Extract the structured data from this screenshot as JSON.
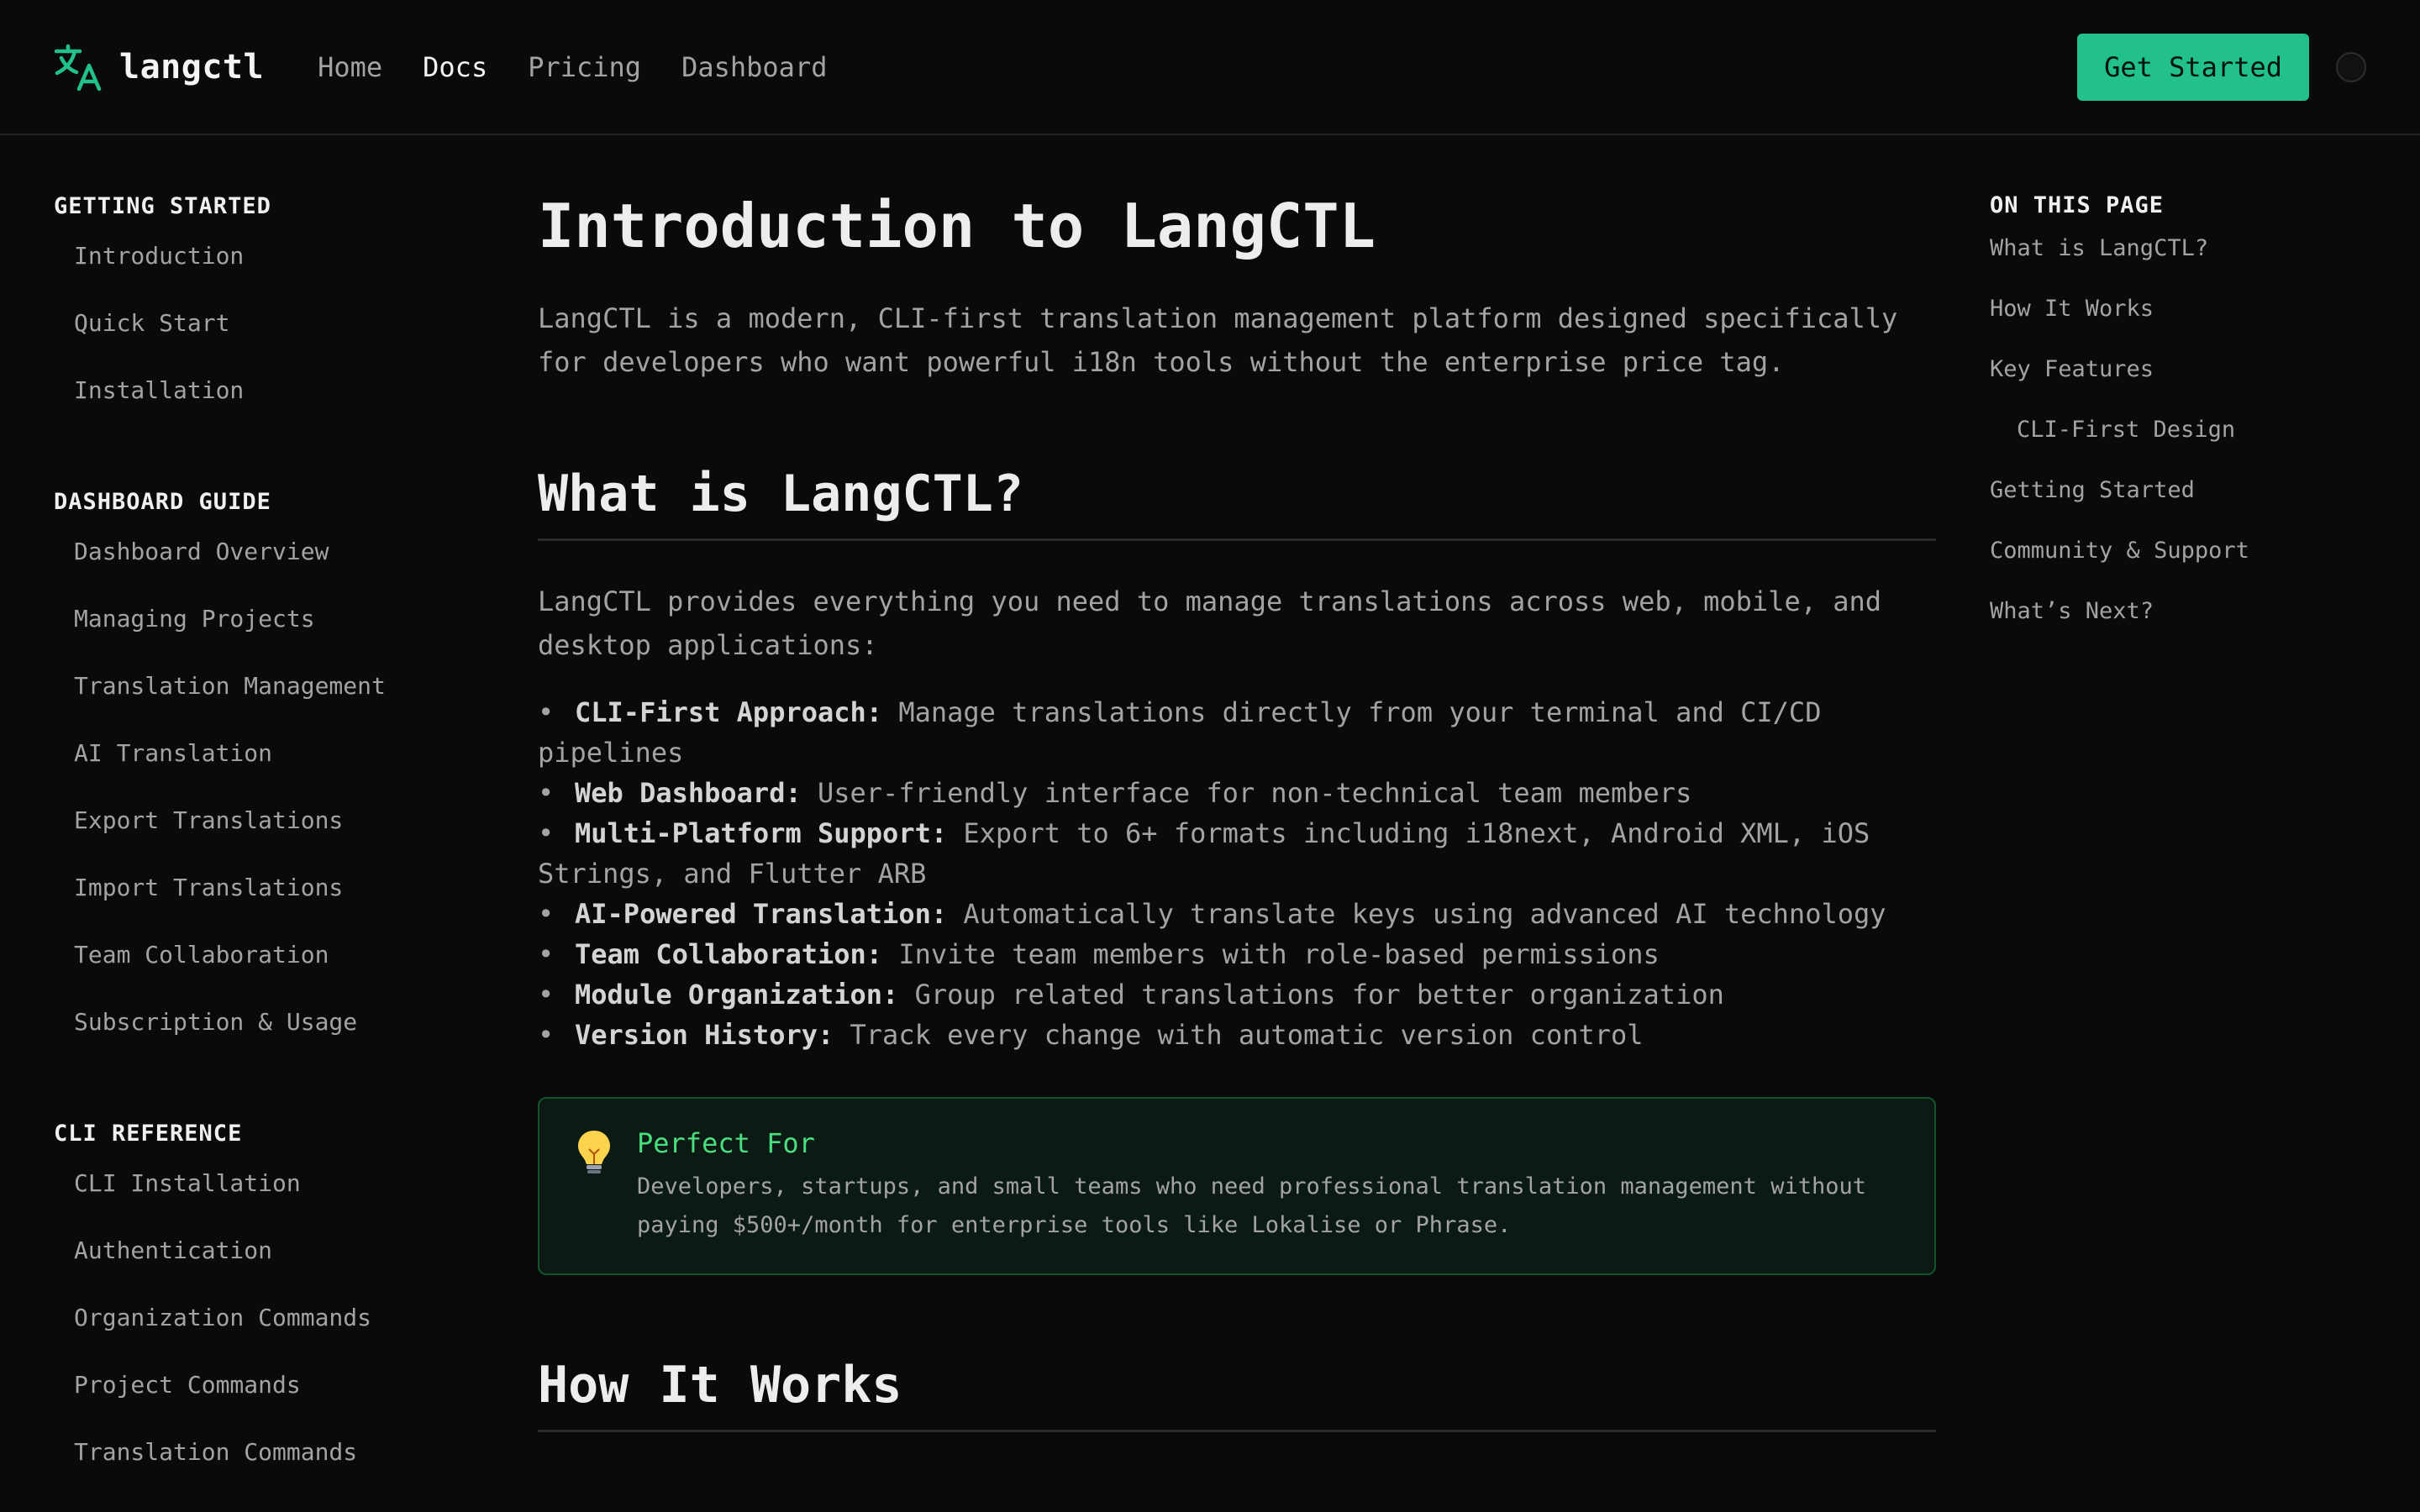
{
  "header": {
    "brand": "langctl",
    "nav": [
      {
        "label": "Home",
        "active": false
      },
      {
        "label": "Docs",
        "active": true
      },
      {
        "label": "Pricing",
        "active": false
      },
      {
        "label": "Dashboard",
        "active": false
      }
    ],
    "cta_label": "Get Started",
    "accent_color": "#22c08a"
  },
  "sidebar": {
    "groups": [
      {
        "heading": "GETTING STARTED",
        "items": [
          "Introduction",
          "Quick Start",
          "Installation"
        ]
      },
      {
        "heading": "DASHBOARD GUIDE",
        "items": [
          "Dashboard Overview",
          "Managing Projects",
          "Translation Management",
          "AI Translation",
          "Export Translations",
          "Import Translations",
          "Team Collaboration",
          "Subscription & Usage"
        ]
      },
      {
        "heading": "CLI REFERENCE",
        "items": [
          "CLI Installation",
          "Authentication",
          "Organization Commands",
          "Project Commands",
          "Translation Commands"
        ]
      }
    ]
  },
  "main": {
    "title": "Introduction to LangCTL",
    "lead": "LangCTL is a modern, CLI-first translation management platform designed specifically for developers who want powerful i18n tools without the enterprise price tag.",
    "section1": {
      "heading": "What is LangCTL?",
      "intro": "LangCTL provides everything you need to manage translations across web, mobile, and desktop applications:",
      "features": [
        {
          "name": "CLI-First Approach",
          "desc": "Manage translations directly from your terminal and CI/CD pipelines"
        },
        {
          "name": "Web Dashboard",
          "desc": "User-friendly interface for non-technical team members"
        },
        {
          "name": "Multi-Platform Support",
          "desc": "Export to 6+ formats including i18next, Android XML, iOS Strings, and Flutter ARB"
        },
        {
          "name": "AI-Powered Translation",
          "desc": "Automatically translate keys using advanced AI technology"
        },
        {
          "name": "Team Collaboration",
          "desc": "Invite team members with role-based permissions"
        },
        {
          "name": "Module Organization",
          "desc": "Group related translations for better organization"
        },
        {
          "name": "Version History",
          "desc": "Track every change with automatic version control"
        }
      ],
      "callout": {
        "icon": "lightbulb-icon",
        "title": "Perfect For",
        "text": "Developers, startups, and small teams who need professional translation management without paying $500+/month for enterprise tools like Lokalise or Phrase."
      }
    },
    "section2": {
      "heading": "How It Works"
    }
  },
  "toc": {
    "heading": "ON THIS PAGE",
    "items": [
      {
        "label": "What is LangCTL?",
        "sub": false
      },
      {
        "label": "How It Works",
        "sub": false
      },
      {
        "label": "Key Features",
        "sub": false
      },
      {
        "label": "CLI-First Design",
        "sub": true
      },
      {
        "label": "Getting Started",
        "sub": false
      },
      {
        "label": "Community & Support",
        "sub": false
      },
      {
        "label": "What’s Next?",
        "sub": false
      }
    ]
  }
}
